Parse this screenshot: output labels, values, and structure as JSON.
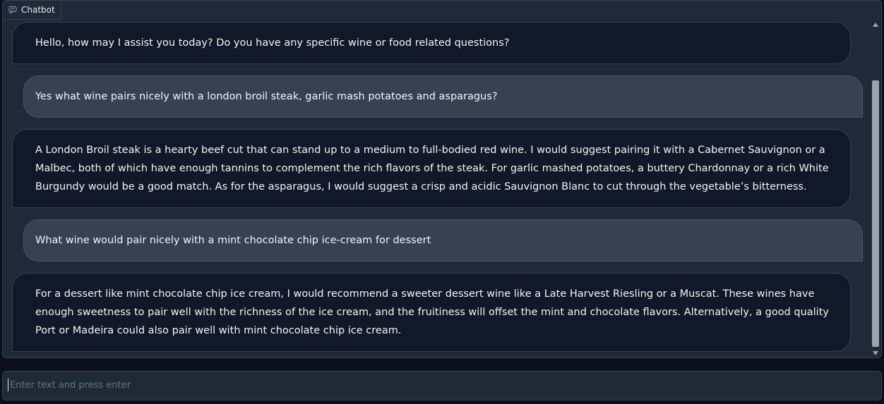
{
  "header": {
    "label": "Chatbot",
    "icon": "chat-icon"
  },
  "messages": [
    {
      "role": "bot",
      "text": "Hello, how may I assist you today? Do you have any specific wine or food related questions?"
    },
    {
      "role": "user",
      "text": "Yes what wine pairs nicely with a london broil steak, garlic mash potatoes and asparagus?"
    },
    {
      "role": "bot",
      "text": "A London Broil steak is a hearty beef cut that can stand up to a medium to full-bodied red wine. I would suggest pairing it with a Cabernet Sauvignon or a Malbec, both of which have enough tannins to complement the rich flavors of the steak. For garlic mashed potatoes, a buttery Chardonnay or a rich White Burgundy would be a good match. As for the asparagus, I would suggest a crisp and acidic Sauvignon Blanc to cut through the vegetable’s bitterness."
    },
    {
      "role": "user",
      "text": "What wine would pair nicely with a mint chocolate chip ice-cream for dessert"
    },
    {
      "role": "bot",
      "text": "For a dessert like mint chocolate chip ice cream, I would recommend a sweeter dessert wine like a Late Harvest Riesling or a Muscat. These wines have enough sweetness to pair well with the richness of the ice cream, and the fruitiness will offset the mint and chocolate flavors. Alternatively, a good quality Port or Madeira could also pair well with mint chocolate chip ice cream."
    }
  ],
  "input": {
    "value": "",
    "placeholder": "Enter text and press enter"
  },
  "colors": {
    "page_background": "#0b0f19",
    "panel_background": "#1f2937",
    "bot_bubble": "#111827",
    "user_bubble": "#374151",
    "text": "#f3f4f6"
  }
}
